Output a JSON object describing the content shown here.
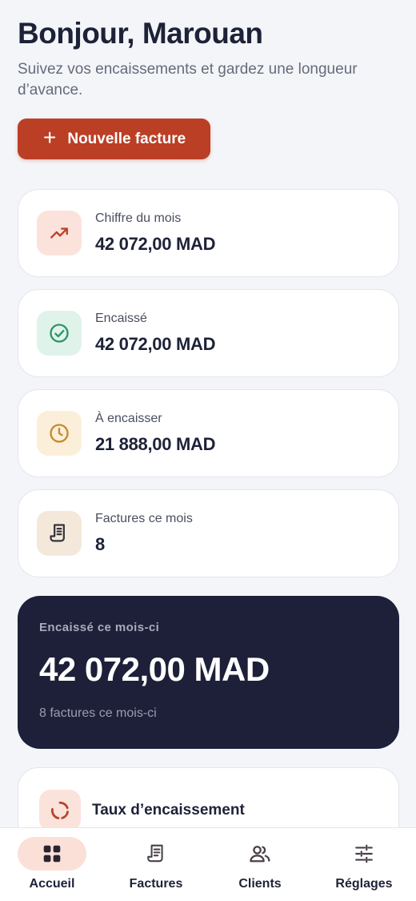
{
  "header": {
    "greeting": "Bonjour, Marouan",
    "subtitle": "Suivez vos encaissements et gardez une longueur d’avance."
  },
  "actions": {
    "new_invoice_label": "Nouvelle facture"
  },
  "stats": [
    {
      "label": "Chiffre du mois",
      "value": "42 072,00 MAD",
      "icon": "trending-up-icon",
      "bg": "#fbe3dc",
      "color": "#b9432b"
    },
    {
      "label": "Encaissé",
      "value": "42 072,00 MAD",
      "icon": "check-circle-icon",
      "bg": "#e0f3ea",
      "color": "#2e9468"
    },
    {
      "label": "À encaisser",
      "value": "21 888,00 MAD",
      "icon": "clock-icon",
      "bg": "#fcefd9",
      "color": "#c58a2c"
    },
    {
      "label": "Factures ce mois",
      "value": "8",
      "icon": "receipt-icon",
      "bg": "#f4e8da",
      "color": "#3a3a42"
    }
  ],
  "hero": {
    "label": "Encaissé ce mois-ci",
    "value": "42 072,00 MAD",
    "sub": "8 factures ce mois-ci"
  },
  "rate": {
    "label": "Taux d’encaissement",
    "icon": "donut-icon"
  },
  "nav": [
    {
      "label": "Accueil",
      "icon": "grid-icon",
      "active": true
    },
    {
      "label": "Factures",
      "icon": "invoice-icon",
      "active": false
    },
    {
      "label": "Clients",
      "icon": "users-icon",
      "active": false
    },
    {
      "label": "Réglages",
      "icon": "sliders-icon",
      "active": false
    }
  ],
  "colors": {
    "accent": "#bb3f25",
    "dark": "#1d2038",
    "background": "#f4f5f9"
  }
}
